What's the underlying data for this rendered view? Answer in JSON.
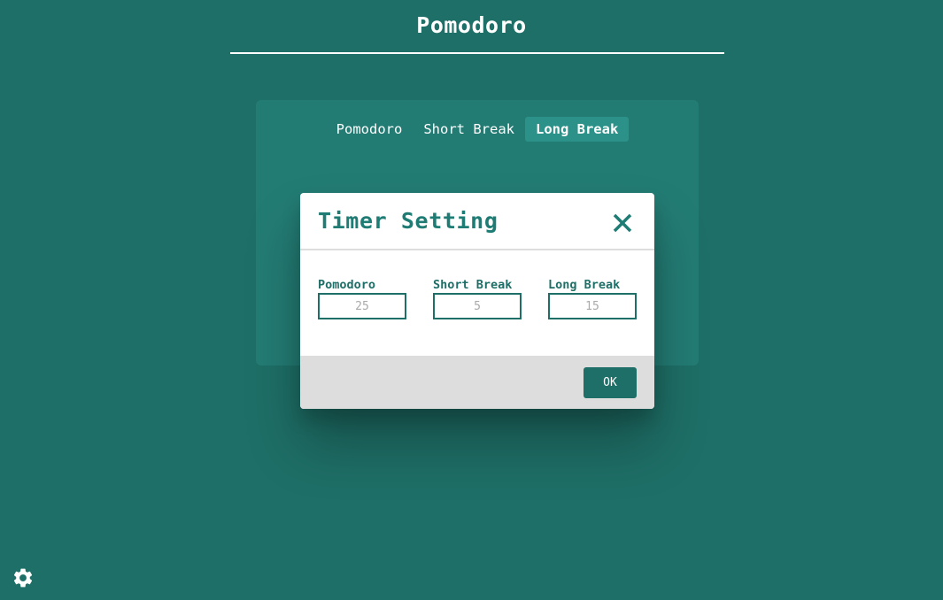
{
  "header": {
    "title": "Pomodoro"
  },
  "tabs": [
    {
      "label": "Pomodoro",
      "active": false
    },
    {
      "label": "Short Break",
      "active": false
    },
    {
      "label": "Long Break",
      "active": true
    }
  ],
  "modal": {
    "title": "Timer Setting",
    "close_icon": "close-icon",
    "fields": [
      {
        "label": "Pomodoro",
        "value": "",
        "placeholder": "25"
      },
      {
        "label": "Short Break",
        "value": "",
        "placeholder": "5"
      },
      {
        "label": "Long Break",
        "value": "",
        "placeholder": "15"
      }
    ],
    "ok_label": "OK"
  },
  "footer": {
    "settings_icon": "gear-icon"
  },
  "colors": {
    "background": "#1e6f67",
    "card": "#237c74",
    "active_tab": "#2c9189",
    "modal_footer": "#dddddd",
    "accent": "#1e7c74"
  }
}
